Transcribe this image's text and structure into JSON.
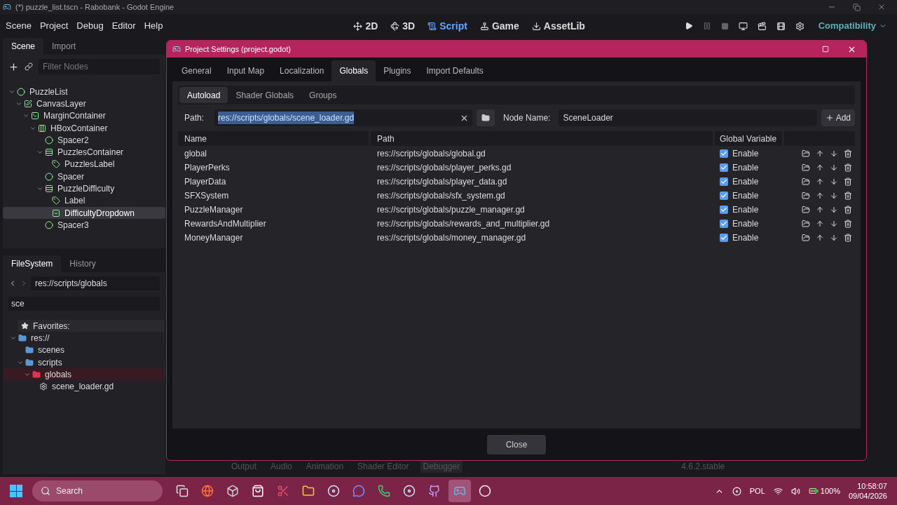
{
  "window": {
    "title": "(*) puzzle_list.tscn - Rabobank - Godot Engine"
  },
  "menu": [
    "Scene",
    "Project",
    "Debug",
    "Editor",
    "Help"
  ],
  "workspaces": [
    {
      "label": "2D",
      "selected": false
    },
    {
      "label": "3D",
      "selected": false
    },
    {
      "label": "Script",
      "selected": true
    },
    {
      "label": "Game",
      "selected": false
    },
    {
      "label": "AssetLib",
      "selected": false
    }
  ],
  "renderer": "Compatibility",
  "scene_dock": {
    "tabs": [
      {
        "label": "Scene",
        "selected": true
      },
      {
        "label": "Import",
        "selected": false
      }
    ],
    "filter_placeholder": "Filter Nodes",
    "tree": [
      {
        "label": "PuzzleList",
        "kind": "node",
        "expanded": true,
        "selected": false,
        "children": [
          {
            "label": "CanvasLayer",
            "kind": "canvas",
            "expanded": true,
            "selected": false,
            "children": [
              {
                "label": "MarginContainer",
                "kind": "margin",
                "expanded": true,
                "selected": false,
                "children": [
                  {
                    "label": "HBoxContainer",
                    "kind": "hbox",
                    "expanded": true,
                    "selected": false,
                    "children": [
                      {
                        "label": "Spacer2",
                        "kind": "node",
                        "selected": false
                      },
                      {
                        "label": "PuzzlesContainer",
                        "kind": "vbox",
                        "expanded": true,
                        "selected": false,
                        "children": [
                          {
                            "label": "PuzzlesLabel",
                            "kind": "label",
                            "selected": false
                          }
                        ]
                      },
                      {
                        "label": "Spacer",
                        "kind": "node",
                        "selected": false
                      },
                      {
                        "label": "PuzzleDifficulty",
                        "kind": "vbox",
                        "expanded": true,
                        "selected": false,
                        "children": [
                          {
                            "label": "Label",
                            "kind": "label",
                            "selected": false
                          },
                          {
                            "label": "DifficultyDropdown",
                            "kind": "option",
                            "selected": true
                          }
                        ]
                      },
                      {
                        "label": "Spacer3",
                        "kind": "node",
                        "selected": false
                      }
                    ]
                  }
                ]
              }
            ]
          }
        ]
      }
    ]
  },
  "filesystem": {
    "tabs": [
      {
        "label": "FileSystem",
        "selected": true
      },
      {
        "label": "History",
        "selected": false
      }
    ],
    "path": "res://scripts/globals",
    "search": "sce",
    "favorites": "Favorites:",
    "tree": [
      {
        "label": "res://",
        "kind": "folder",
        "color": "#5a96d8",
        "expanded": true,
        "children": [
          {
            "label": "scenes",
            "kind": "folder",
            "color": "#5a96d8"
          },
          {
            "label": "scripts",
            "kind": "folder",
            "color": "#5a96d8",
            "expanded": true,
            "children": [
              {
                "label": "globals",
                "kind": "folder",
                "color": "#e0334f",
                "expanded": true,
                "children": [
                  {
                    "label": "scene_loader.gd",
                    "kind": "script"
                  }
                ]
              }
            ]
          }
        ]
      }
    ]
  },
  "dialog": {
    "title": "Project Settings (project.godot)",
    "tabs": [
      {
        "label": "General",
        "selected": false
      },
      {
        "label": "Input Map",
        "selected": false
      },
      {
        "label": "Localization",
        "selected": false
      },
      {
        "label": "Globals",
        "selected": true
      },
      {
        "label": "Plugins",
        "selected": false
      },
      {
        "label": "Import Defaults",
        "selected": false
      }
    ],
    "subtabs": [
      {
        "label": "Autoload",
        "selected": true
      },
      {
        "label": "Shader Globals",
        "selected": false
      },
      {
        "label": "Groups",
        "selected": false
      }
    ],
    "path_label": "Path:",
    "path_value": "res://scripts/globals/scene_loader.gd",
    "node_name_label": "Node Name:",
    "node_name_value": "SceneLoader",
    "add": "Add",
    "columns": [
      "Name",
      "Path",
      "Global Variable"
    ],
    "rows": [
      {
        "name": "global",
        "path": "res://scripts/globals/global.gd",
        "enabled": true,
        "enable_label": "Enable"
      },
      {
        "name": "PlayerPerks",
        "path": "res://scripts/globals/player_perks.gd",
        "enabled": true,
        "enable_label": "Enable"
      },
      {
        "name": "PlayerData",
        "path": "res://scripts/globals/player_data.gd",
        "enabled": true,
        "enable_label": "Enable"
      },
      {
        "name": "SFXSystem",
        "path": "res://scripts/globals/sfx_system.gd",
        "enabled": true,
        "enable_label": "Enable"
      },
      {
        "name": "PuzzleManager",
        "path": "res://scripts/globals/puzzle_manager.gd",
        "enabled": true,
        "enable_label": "Enable"
      },
      {
        "name": "RewardsAndMultiplier",
        "path": "res://scripts/globals/rewards_and_multiplier.gd",
        "enabled": true,
        "enable_label": "Enable"
      },
      {
        "name": "MoneyManager",
        "path": "res://scripts/globals/money_manager.gd",
        "enabled": true,
        "enable_label": "Enable"
      }
    ],
    "close": "Close"
  },
  "bottom_panel": {
    "tabs": [
      {
        "label": "Output",
        "selected": false
      },
      {
        "label": "Audio",
        "selected": false
      },
      {
        "label": "Animation",
        "selected": false
      },
      {
        "label": "Shader Editor",
        "selected": false
      },
      {
        "label": "Debugger",
        "selected": true
      }
    ],
    "version": "4.6.2.stable"
  },
  "taskbar": {
    "search_placeholder": "Search",
    "apps": [
      {
        "kind": "taskview",
        "selected": false
      },
      {
        "kind": "browser",
        "selected": false
      },
      {
        "kind": "cube",
        "selected": false
      },
      {
        "kind": "store",
        "selected": false
      },
      {
        "kind": "snip",
        "selected": false
      },
      {
        "kind": "files",
        "selected": false
      },
      {
        "kind": "steam",
        "selected": false
      },
      {
        "kind": "chat",
        "selected": false
      },
      {
        "kind": "phone",
        "selected": false
      },
      {
        "kind": "steam",
        "selected": false
      },
      {
        "kind": "github",
        "selected": false
      },
      {
        "kind": "godot",
        "selected": true
      },
      {
        "kind": "record",
        "selected": false
      }
    ],
    "language": "POL",
    "battery": "100%",
    "time": "10:58:07",
    "date": "09/04/2026"
  }
}
